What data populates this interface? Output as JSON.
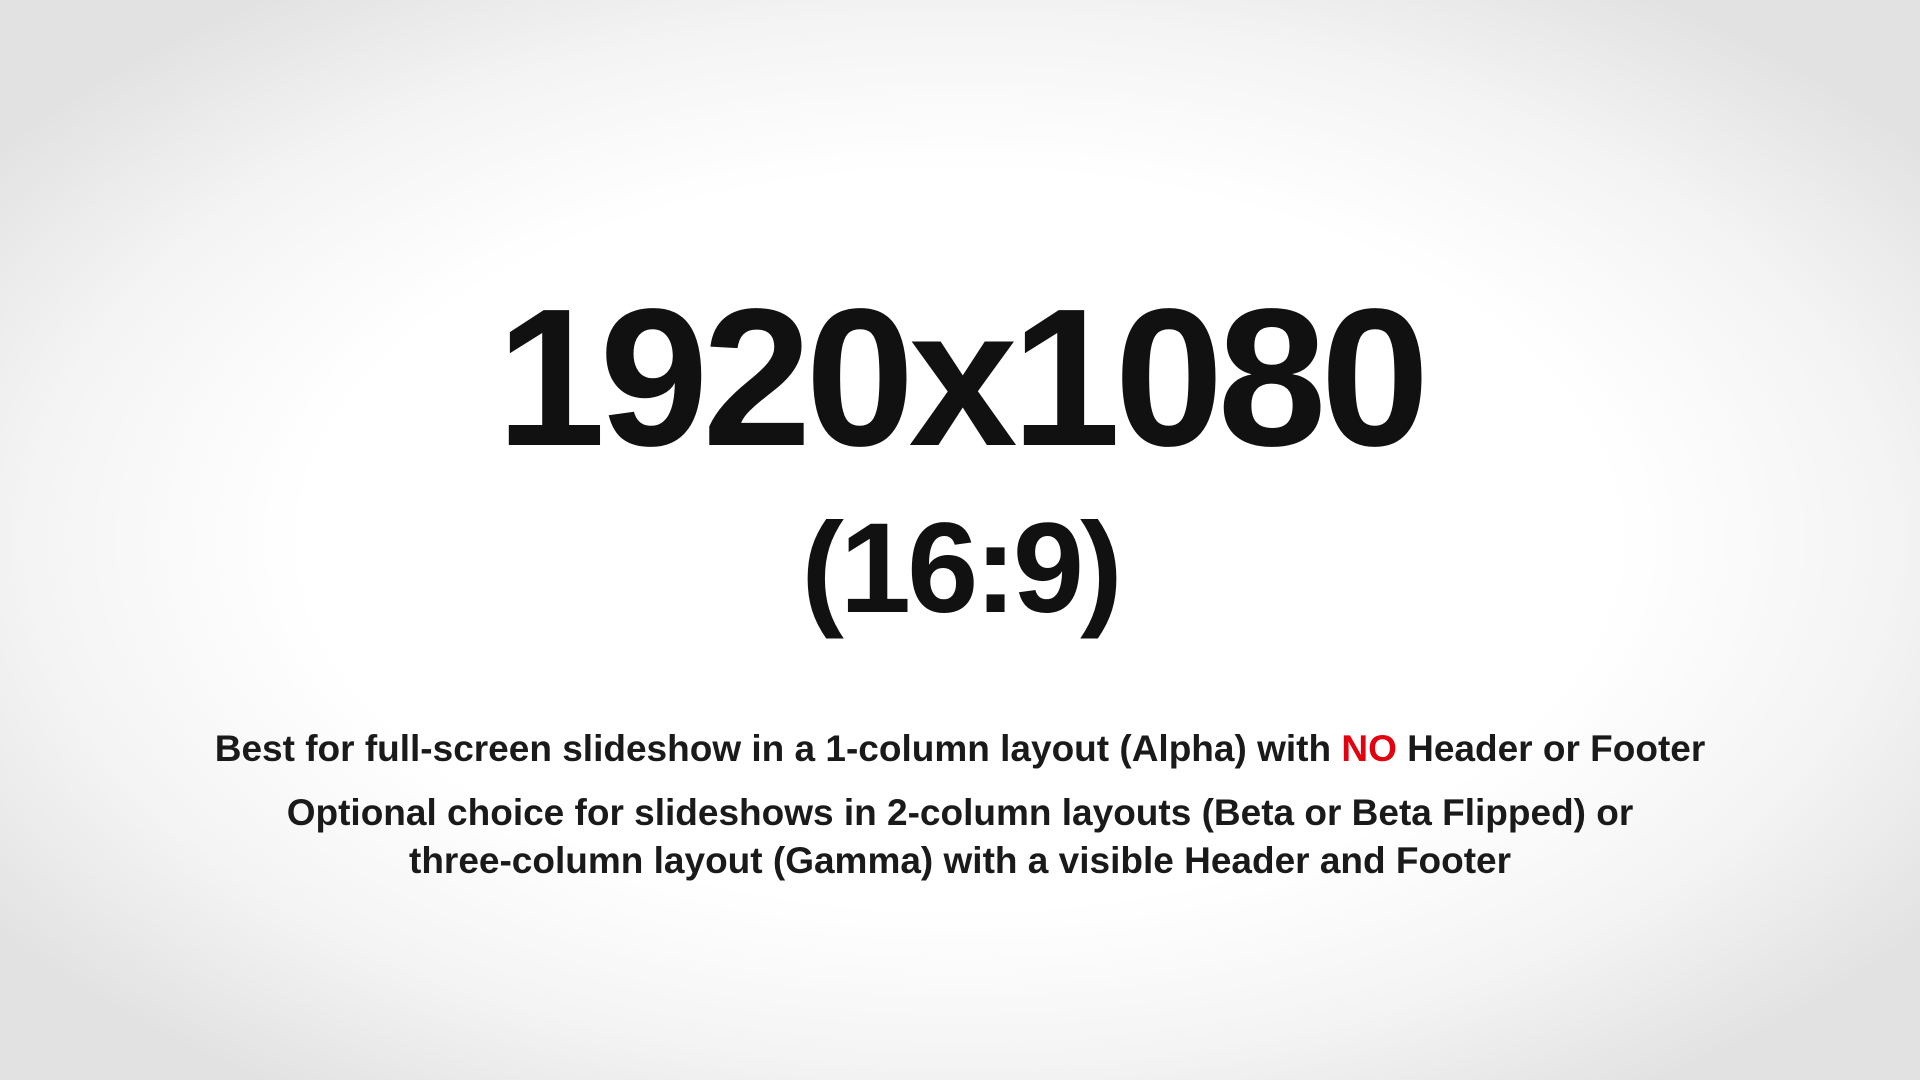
{
  "headline": "1920x1080",
  "ratio": "(16:9)",
  "description": {
    "line1_before": "Best for full-screen slideshow in a 1-column layout (Alpha) with ",
    "line1_emphasis": "NO",
    "line1_after": " Header or Footer",
    "line2": "Optional choice for slideshows in 2-column layouts (Beta or Beta Flipped) or",
    "line3": "three-column layout (Gamma) with a visible Header and Footer"
  },
  "colors": {
    "text": "#111111",
    "emphasis": "#e3000f",
    "background_center": "#ffffff",
    "background_edge": "#e2e2e2"
  }
}
